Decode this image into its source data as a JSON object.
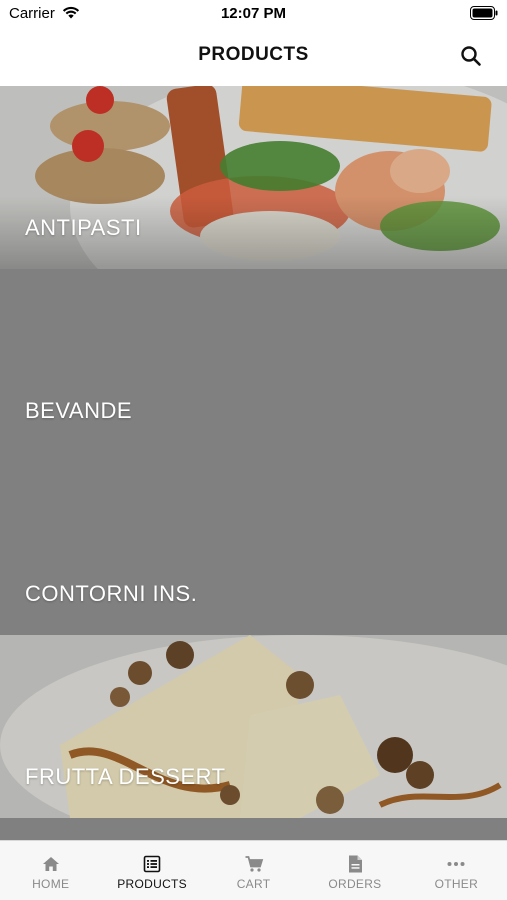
{
  "status_bar": {
    "carrier": "Carrier",
    "time": "12:07 PM"
  },
  "header": {
    "title": "PRODUCTS",
    "search_icon": "search-icon"
  },
  "categories": [
    {
      "label": "ANTIPASTI",
      "image": "appetizer-plate-photo"
    },
    {
      "label": "BEVANDE",
      "image": null
    },
    {
      "label": "CONTORNI INS.",
      "image": null
    },
    {
      "label": "FRUTTA DESSERT",
      "image": "dessert-photo"
    }
  ],
  "tab_bar": {
    "active": "PRODUCTS",
    "items": [
      {
        "label": "HOME",
        "icon": "home-icon"
      },
      {
        "label": "PRODUCTS",
        "icon": "menu-list-icon"
      },
      {
        "label": "CART",
        "icon": "cart-icon"
      },
      {
        "label": "ORDERS",
        "icon": "document-icon"
      },
      {
        "label": "OTHER",
        "icon": "more-dots-icon"
      }
    ]
  },
  "colors": {
    "tile_gray": "#808080",
    "active_tab": "#111111",
    "inactive_tab": "#8a8a8a"
  }
}
